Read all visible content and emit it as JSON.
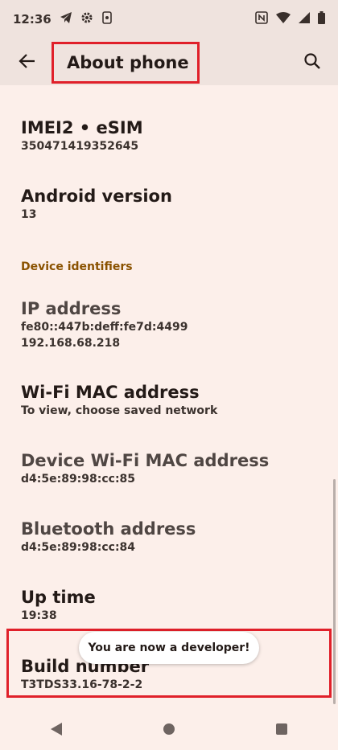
{
  "status_bar": {
    "time": "12:36"
  },
  "app_bar": {
    "title": "About phone"
  },
  "items": [
    {
      "title": "IMEI2 • eSIM",
      "subtitle": "350471419352645"
    },
    {
      "title": "Android version",
      "subtitle": "13"
    },
    {
      "title": "IP address",
      "subtitle": "fe80::447b:deff:fe7d:4499",
      "subtitle2": "192.168.68.218"
    },
    {
      "title": "Wi-Fi MAC address",
      "subtitle": "To view, choose saved network"
    },
    {
      "title": "Device Wi-Fi MAC address",
      "subtitle": "d4:5e:89:98:cc:85"
    },
    {
      "title": "Bluetooth address",
      "subtitle": "d4:5e:89:98:cc:84"
    },
    {
      "title": "Up time",
      "subtitle": "19:38"
    },
    {
      "title": "Build number",
      "subtitle": "T3TDS33.16-78-2-2"
    }
  ],
  "section_header": "Device identifiers",
  "toast": "You are now a developer!",
  "colors": {
    "highlight": "#e0202a",
    "accent": "#8a5200",
    "background": "#fcefea"
  }
}
